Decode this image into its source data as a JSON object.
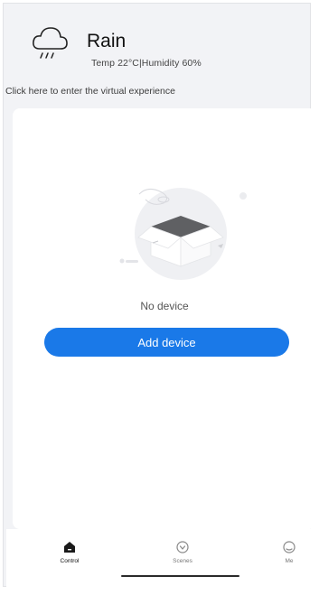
{
  "weather": {
    "condition": "Rain",
    "detail": "Temp 22°C|Humidity 60%",
    "icon": "rain-cloud-icon"
  },
  "virtual_link": "Click here to enter the virtual experience",
  "empty_state": {
    "illustration": "open-box-icon",
    "message": "No device",
    "button_label": "Add device"
  },
  "tabbar": {
    "tabs": [
      {
        "label": "Control",
        "icon": "home-icon",
        "active": true
      },
      {
        "label": "Scenes",
        "icon": "scenes-icon",
        "active": false
      },
      {
        "label": "Me",
        "icon": "me-icon",
        "active": false
      }
    ]
  },
  "colors": {
    "accent": "#1a79e8",
    "background": "#f2f3f6",
    "card": "#ffffff"
  }
}
